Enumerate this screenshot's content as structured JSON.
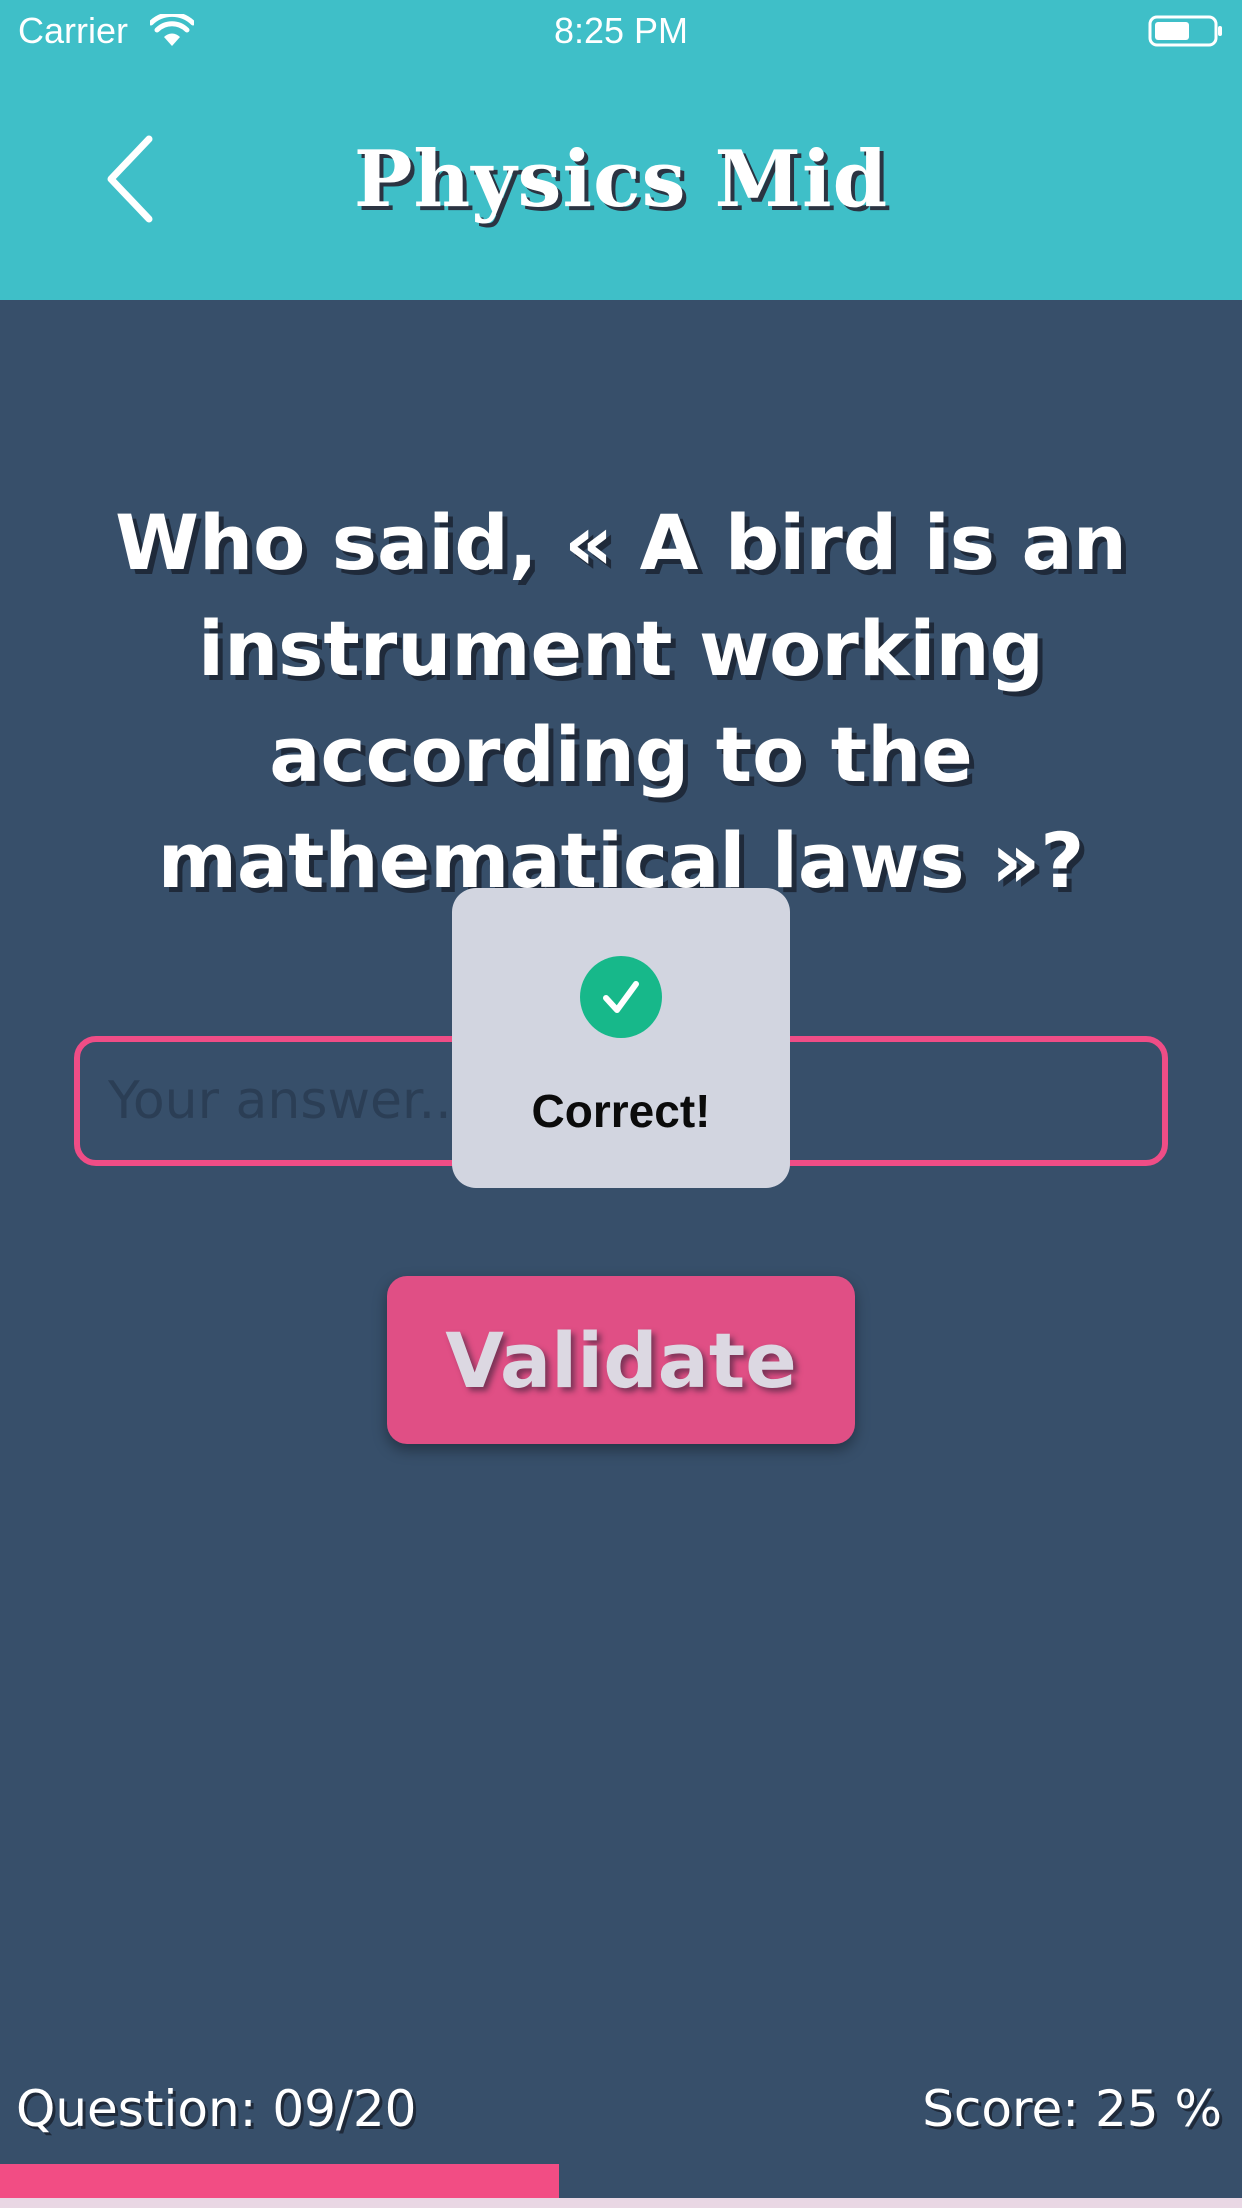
{
  "status_bar": {
    "carrier": "Carrier",
    "time": "8:25 PM"
  },
  "nav": {
    "title": "Physics Mid",
    "back_icon": "chevron-left-icon"
  },
  "question": {
    "text": "Who said, « A bird is an instrument working according to the mathematical laws »?"
  },
  "answer": {
    "placeholder": "Your answer...",
    "value": ""
  },
  "hud": {
    "icon": "check-circle-icon",
    "message": "Correct!"
  },
  "validate": {
    "label": "Validate"
  },
  "footer": {
    "question_counter": "Question: 09/20",
    "score": "Score: 25 %",
    "progress_fraction": 0.45
  },
  "colors": {
    "header": "#3fbfc8",
    "background": "#374f6a",
    "accent": "#e04f85",
    "success": "#17b88a"
  }
}
